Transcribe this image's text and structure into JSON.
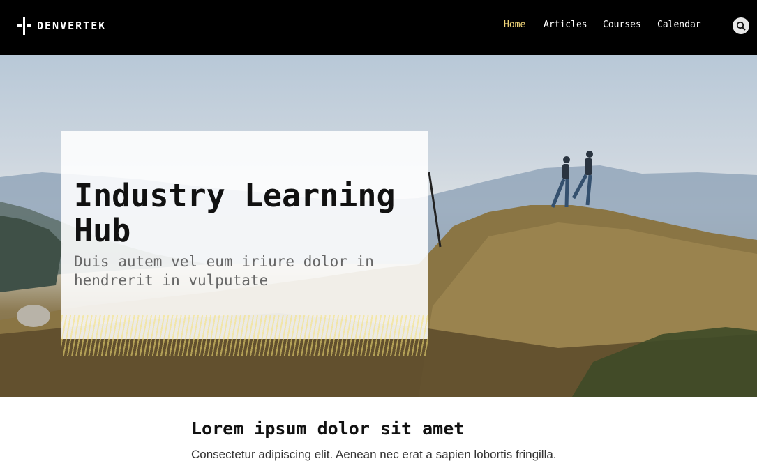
{
  "brand": {
    "name": "DENVERTEK"
  },
  "nav": {
    "items": [
      {
        "label": "Home",
        "active": true
      },
      {
        "label": "Articles",
        "active": false
      },
      {
        "label": "Courses",
        "active": false
      },
      {
        "label": "Calendar",
        "active": false
      }
    ],
    "active_color": "#f3d77a"
  },
  "search": {
    "icon": "search-icon"
  },
  "hero": {
    "title": "Industry Learning Hub",
    "subtitle": "Duis autem vel eum iriure dolor in hendrerit in vulputate"
  },
  "content": {
    "heading": "Lorem ipsum dolor sit amet",
    "text": "Consectetur adipiscing elit. Aenean nec erat a sapien lobortis fringilla."
  },
  "colors": {
    "header_bg": "#000000",
    "accent": "#f3d77a"
  }
}
